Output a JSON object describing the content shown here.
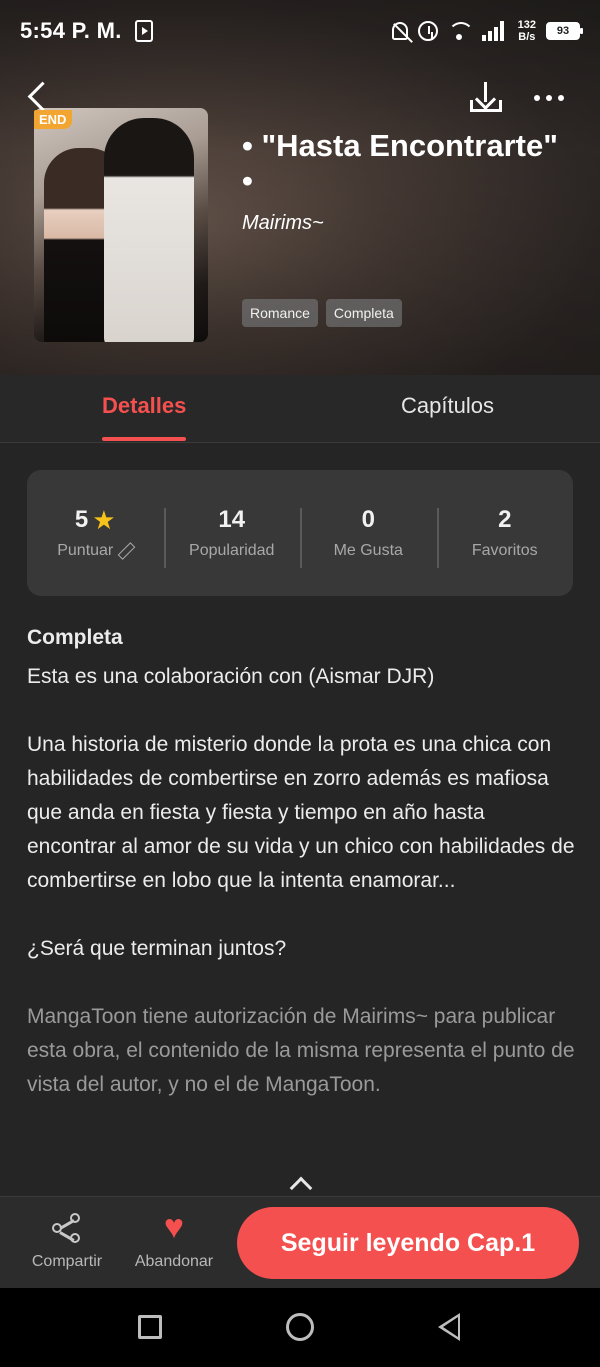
{
  "status_bar": {
    "time": "5:54 P. M.",
    "network_speed_value": "132",
    "network_speed_unit": "B/s",
    "battery": "93"
  },
  "header": {
    "end_badge": "END",
    "title": "• \"Hasta Encontrarte\" •",
    "author": "Mairims~",
    "tags": [
      "Romance",
      "Completa"
    ]
  },
  "tabs": {
    "details": "Detalles",
    "chapters": "Capítulos"
  },
  "stats": [
    {
      "value": "5",
      "label": "Puntuar",
      "icon": "star-icon"
    },
    {
      "value": "14",
      "label": "Popularidad"
    },
    {
      "value": "0",
      "label": "Me Gusta"
    },
    {
      "value": "2",
      "label": "Favoritos"
    }
  ],
  "description": {
    "heading": "Completa",
    "p1": "Esta es una colaboración con (Aismar DJR)",
    "p2": "Una historia de misterio donde la prota es una chica con habilidades de combertirse en zorro además es mafiosa que anda en fiesta y fiesta y tiempo en año hasta encontrar al amor de su vida y un chico con habilidades de combertirse en lobo que la intenta enamorar...",
    "p3": "¿Será que terminan juntos?",
    "disclaimer": "MangaToon tiene autorización de Mairims~ para publicar esta obra, el contenido de la misma representa el punto de vista del autor, y no el de MangaToon."
  },
  "actions": {
    "share": "Compartir",
    "abandon": "Abandonar",
    "continue": "Seguir leyendo Cap.1"
  },
  "colors": {
    "accent": "#f4504f",
    "star": "#f7c21a",
    "end_badge": "#f2a531",
    "background": "#252525"
  }
}
